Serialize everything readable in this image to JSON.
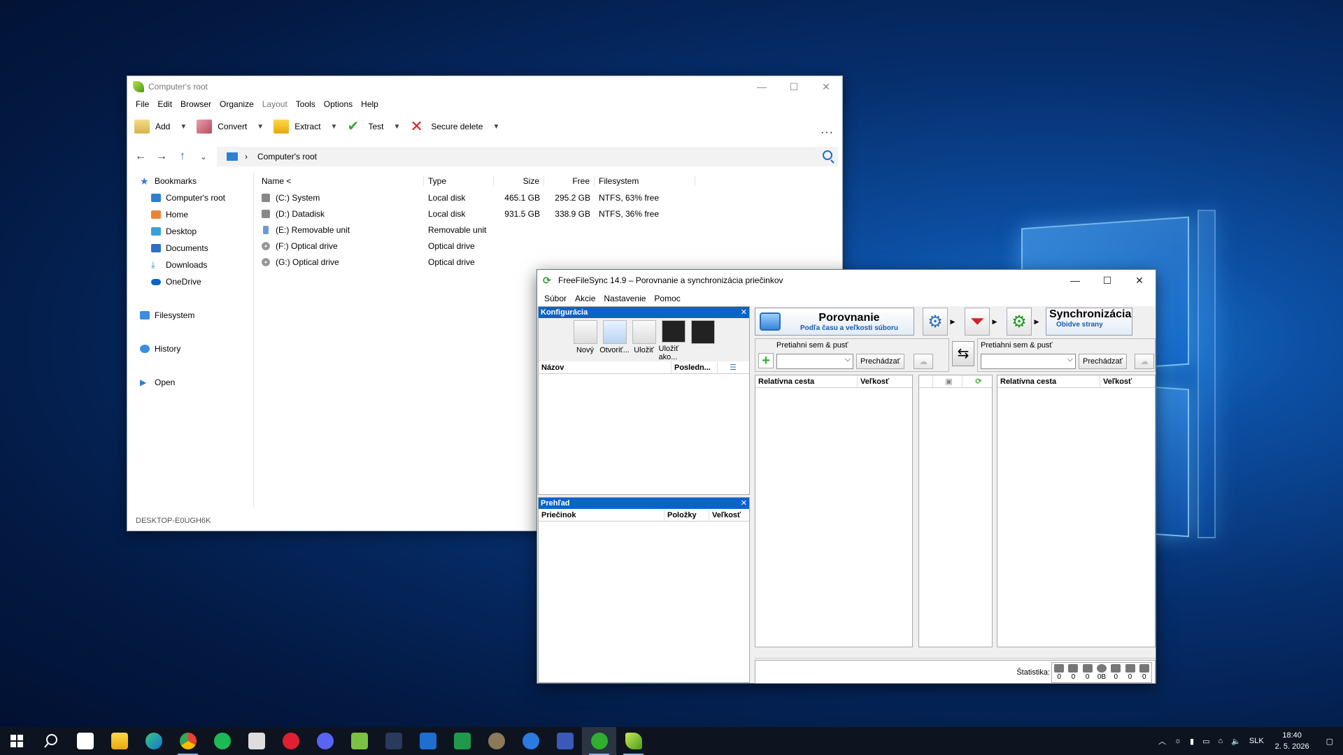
{
  "colors": {
    "accent": "#0a64c8",
    "taskbar": "#0d1420",
    "peazip_green": "#7cc142"
  },
  "peazip": {
    "title": "Computer's root",
    "menu": [
      "File",
      "Edit",
      "Browser",
      "Organize",
      "Layout",
      "Tools",
      "Options",
      "Help"
    ],
    "toolbar": {
      "add": "Add",
      "convert": "Convert",
      "extract": "Extract",
      "test": "Test",
      "secure_delete": "Secure delete",
      "more": "···"
    },
    "address": "Computer's root",
    "sidebar": {
      "bookmarks": "Bookmarks",
      "items": [
        "Computer's root",
        "Home",
        "Desktop",
        "Documents",
        "Downloads",
        "OneDrive"
      ],
      "filesystem": "Filesystem",
      "history": "History",
      "open": "Open"
    },
    "columns": {
      "name": "Name <",
      "type": "Type",
      "size": "Size",
      "free": "Free",
      "fs": "Filesystem"
    },
    "rows": [
      {
        "name": "(C:) System",
        "type": "Local disk",
        "size": "465.1 GB",
        "free": "295.2 GB",
        "fs": "NTFS, 63% free",
        "icon": "disk-icon"
      },
      {
        "name": "(D:) Datadisk",
        "type": "Local disk",
        "size": "931.5 GB",
        "free": "338.9 GB",
        "fs": "NTFS, 36% free",
        "icon": "disk-icon"
      },
      {
        "name": "(E:) Removable unit",
        "type": "Removable unit",
        "size": "",
        "free": "",
        "fs": "",
        "icon": "usb-icon"
      },
      {
        "name": "(F:) Optical drive",
        "type": "Optical drive",
        "size": "",
        "free": "",
        "fs": "",
        "icon": "optical-icon"
      },
      {
        "name": "(G:) Optical drive",
        "type": "Optical drive",
        "size": "",
        "free": "",
        "fs": "",
        "icon": "optical-icon"
      }
    ],
    "status": "DESKTOP-E0UGH6K"
  },
  "ffs": {
    "title": "FreeFileSync 14.9 – Porovnanie a synchronizácia priečinkov",
    "menu": [
      "Súbor",
      "Akcie",
      "Nastavenie",
      "Pomoc"
    ],
    "config_panel": {
      "title": "Konfigurácia",
      "tools": [
        "Nový",
        "Otvoriť...",
        "Uložiť",
        "Uložiť ako..."
      ],
      "col_name": "Názov",
      "col_last": "Posledn..."
    },
    "overview_panel": {
      "title": "Prehľad",
      "col_folder": "Priečinok",
      "col_items": "Položky",
      "col_size": "Veľkosť"
    },
    "compare": {
      "label": "Porovnanie",
      "sub": "Podľa času a veľkosti súboru"
    },
    "sync": {
      "label": "Synchronizácia",
      "sub": "Obidve strany"
    },
    "drop_label": "Pretiahni sem & pusť",
    "browse": "Prechádzať",
    "grid": {
      "rel_path": "Relatívna cesta",
      "size": "Veľkosť"
    },
    "stats": {
      "label": "Štatistika:",
      "values": [
        "0",
        "0",
        "0",
        "0B",
        "0",
        "0",
        "0"
      ]
    }
  },
  "taskbar": {
    "apps": [
      "search-icon",
      "store-icon",
      "explorer-icon",
      "edge-icon",
      "chrome-icon",
      "spotify-icon",
      "video-editor-icon",
      "opera-icon",
      "discord-icon",
      "notepad-icon",
      "davinci-icon",
      "word-icon",
      "excel-icon",
      "gimp-icon",
      "app-icon",
      "floppy-icon",
      "freefilesync-icon",
      "peazip-icon"
    ],
    "lang": "SLK",
    "time": "18:40",
    "date": "2. 5. 2026"
  }
}
